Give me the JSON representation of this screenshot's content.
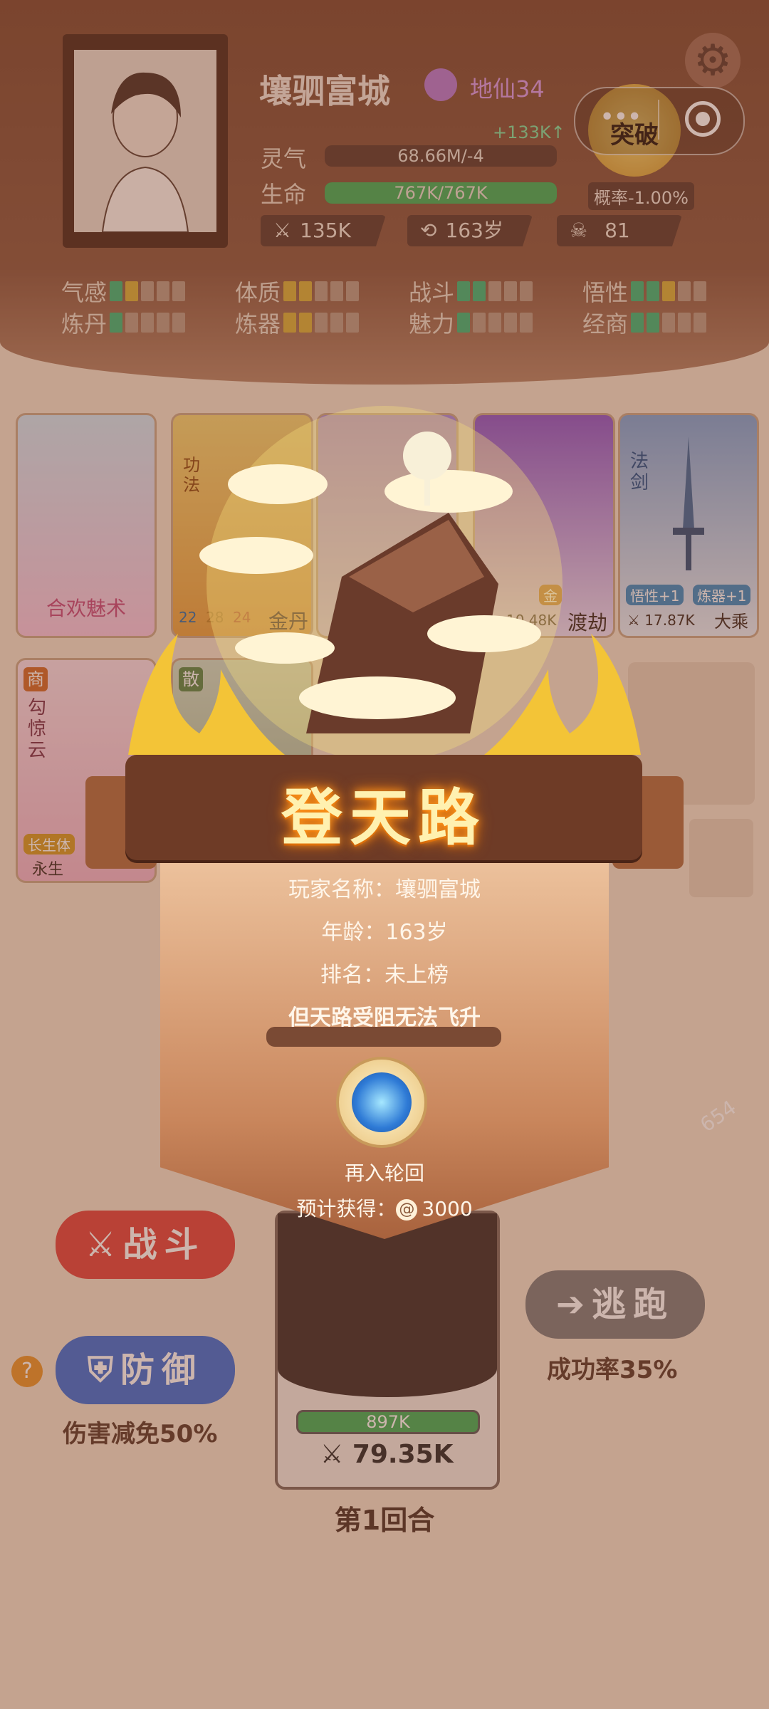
{
  "player": {
    "name": "壤驷富城",
    "realm": "地仙34",
    "gain": "+133K↑",
    "lingqi_label": "灵气",
    "lingqi_value": "68.66M/-4",
    "life_label": "生命",
    "life_value": "767K/767K",
    "life_fraction": 1.0,
    "power": "135K",
    "age": "163岁",
    "kills": "81",
    "breakthrough_label": "突破",
    "breakthrough_rate": "概率-1.00%"
  },
  "attributes": [
    {
      "label": "气感",
      "filled": [
        "g",
        "y"
      ],
      "total": 5
    },
    {
      "label": "体质",
      "filled": [
        "y",
        "y"
      ],
      "total": 5
    },
    {
      "label": "战斗",
      "filled": [
        "g",
        "g"
      ],
      "total": 5
    },
    {
      "label": "悟性",
      "filled": [
        "g",
        "g",
        "y"
      ],
      "total": 5
    },
    {
      "label": "炼丹",
      "filled": [
        "g"
      ],
      "total": 5
    },
    {
      "label": "炼器",
      "filled": [
        "y",
        "y"
      ],
      "total": 5
    },
    {
      "label": "魅力",
      "filled": [
        "g"
      ],
      "total": 5
    },
    {
      "label": "经商",
      "filled": [
        "g",
        "g"
      ],
      "total": 5
    }
  ],
  "cards": {
    "card1_name": "合欢魅术",
    "card2_type": "功法",
    "card2_name": "金丹",
    "card2_nums": [
      "22",
      "28",
      "24"
    ],
    "card4_value": "10.48K",
    "card4_name": "渡劫",
    "card4_elem": "金",
    "card5_type": "法剑",
    "card5_tag1": "悟性+1",
    "card5_tag2": "炼器+1",
    "card5_power": "17.87K",
    "card5_realm": "大乘",
    "char1_type": "商",
    "char1_name": "勾惊云",
    "char1_tag": "长生体",
    "char1_status": "永生",
    "char2_type": "散"
  },
  "battle": {
    "fight_label": "战斗",
    "defend_label": "防御",
    "defend_note": "伤害减免50%",
    "flee_label": "逃跑",
    "flee_note": "成功率35%",
    "enemy_hp": "897K",
    "enemy_power": "79.35K",
    "round": "第1回合",
    "gem_count": "654",
    "help": "?"
  },
  "popup": {
    "title": "登天路",
    "name_line": "玩家名称：壤驷富城",
    "age_line": "年龄：163岁",
    "rank_line": "排名：未上榜",
    "blocked_line": "但天路受阻无法飞升",
    "reincarnate_label": "再入轮回",
    "reward_label": "预计获得：",
    "reward_value": "3000"
  },
  "colors": {
    "accent_green": "#3db67a",
    "accent_gold": "#d7b13a",
    "fight_red": "#e0453f",
    "defend_blue": "#3d6fd6",
    "flee_gray": "#7d7d7d"
  }
}
